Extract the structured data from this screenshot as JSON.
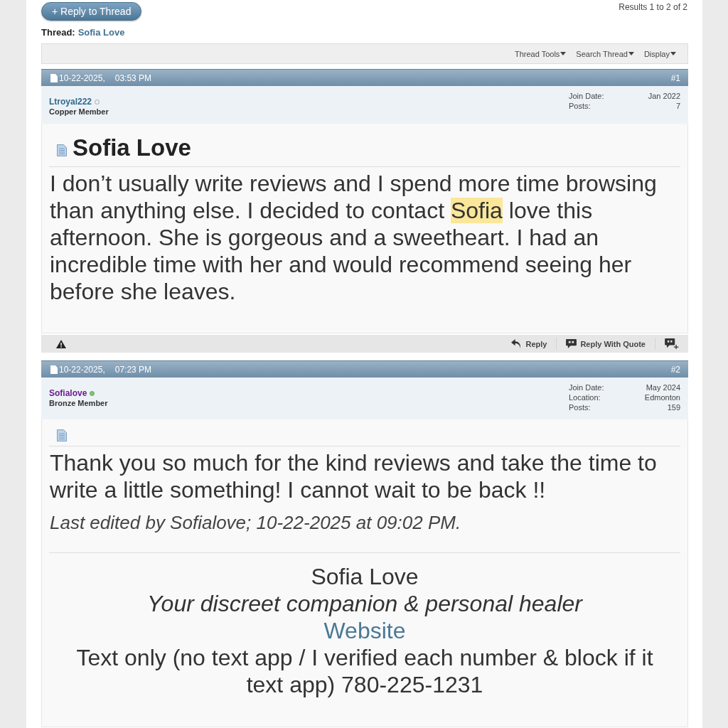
{
  "top_bar": {
    "reply_button": "+ Reply to Thread",
    "results": "Results 1 to 2 of 2"
  },
  "thread": {
    "label": "Thread:",
    "title": "Sofia Love"
  },
  "toolbar": [
    {
      "label": "Thread Tools"
    },
    {
      "label": "Search Thread"
    },
    {
      "label": "Display"
    }
  ],
  "posts": [
    {
      "date": "10-22-2025,",
      "time": "03:53 PM",
      "number": "#1",
      "user": {
        "name": "Ltroyal222",
        "color": "#2f6a8c",
        "online": false,
        "rank": "Copper Member"
      },
      "details": [
        {
          "label": "Join Date:",
          "value": "Jan 2022"
        },
        {
          "label": "Posts:",
          "value": "7"
        }
      ],
      "title": "Sofia Love",
      "body": [
        {
          "text": "I don’t usually write reviews and I spend more time browsing than anything else. I decided to contact ",
          "highlighted": false
        },
        {
          "text": "Sofia",
          "highlighted": true
        },
        {
          "text": " love this afternoon. She is gorgeous and a sweetheart. I had an incredible time with her and would recommend seeing her before she leaves.",
          "highlighted": false
        }
      ],
      "actions": [
        {
          "kind": "reply",
          "label": "Reply"
        },
        {
          "kind": "quote",
          "label": "Reply With Quote"
        },
        {
          "kind": "multiquote"
        }
      ]
    },
    {
      "date": "10-22-2025,",
      "time": "07:23 PM",
      "number": "#2",
      "user": {
        "name": "Sofialove",
        "color": "#6b1e8c",
        "online": true,
        "rank": "Bronze Member"
      },
      "details": [
        {
          "label": "Join Date:",
          "value": "May 2024"
        },
        {
          "label": "Location:",
          "value": "Edmonton"
        },
        {
          "label": "Posts:",
          "value": "159"
        }
      ],
      "body": [
        {
          "text": "Thank you so much for the kind reviews and take the time to write a little something! I cannot wait to be back !!",
          "highlighted": false
        }
      ],
      "edit_note": "Last edited by Sofialove; 10-22-2025 at 09:02 PM.",
      "signature": [
        {
          "kind": "name",
          "text": "Sofia Love"
        },
        {
          "kind": "tagline",
          "text": "Your discreet companion & personal healer"
        },
        {
          "kind": "link",
          "text": "Website"
        },
        {
          "kind": "plain",
          "text": "Text only (no text app / I verified each number & block if it text app) 780-225-1231"
        }
      ]
    }
  ]
}
